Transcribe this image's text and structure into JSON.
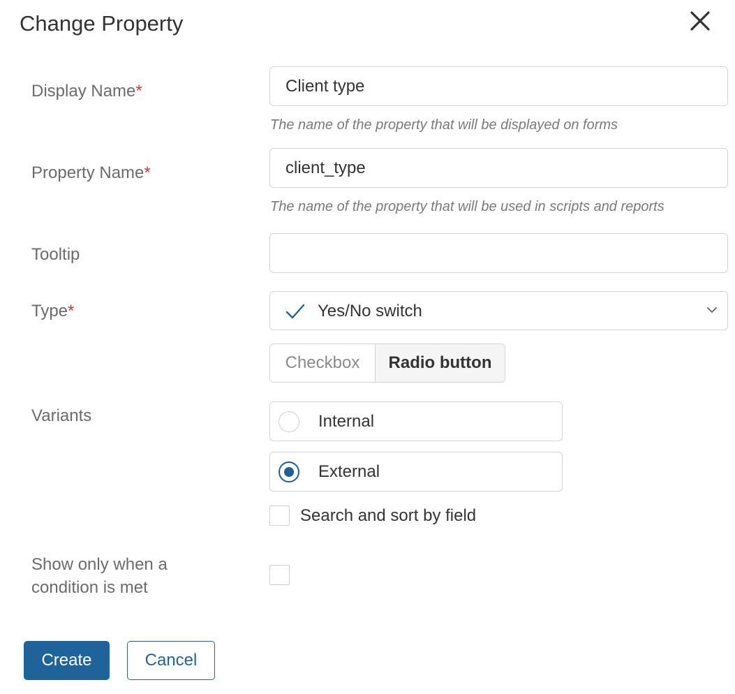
{
  "dialog": {
    "title": "Change Property"
  },
  "fields": {
    "display_name": {
      "label": "Display Name",
      "required_mark": "*",
      "value": "Client type",
      "hint": "The name of the property that will be displayed on forms"
    },
    "property_name": {
      "label": "Property Name",
      "required_mark": "*",
      "value": "client_type",
      "hint": "The name of the property that will be used in scripts and reports"
    },
    "tooltip": {
      "label": "Tooltip",
      "value": ""
    },
    "type": {
      "label": "Type",
      "required_mark": "*",
      "selected": "Yes/No switch",
      "icon": "checkmark-icon",
      "display_modes": [
        "Checkbox",
        "Radio button"
      ],
      "active_mode": "Radio button"
    },
    "variants": {
      "label": "Variants",
      "options": [
        {
          "label": "Internal",
          "selected": false
        },
        {
          "label": "External",
          "selected": true
        }
      ],
      "search_sort_label": "Search and sort by field",
      "search_sort_checked": false
    },
    "condition": {
      "label_line1": "Show only when a",
      "label_line2": "condition is met",
      "checked": false
    }
  },
  "actions": {
    "create_label": "Create",
    "cancel_label": "Cancel"
  },
  "colors": {
    "accent": "#1f639b",
    "required": "#d9363e"
  }
}
